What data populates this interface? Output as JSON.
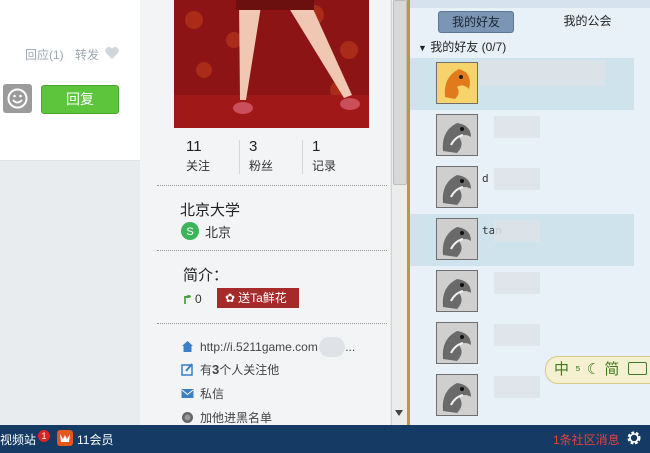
{
  "feed": {
    "reply_count_label": "回应(1)",
    "forward_label": "转发",
    "reply_button": "回复"
  },
  "profile": {
    "stats": [
      {
        "num": "11",
        "label": "关注"
      },
      {
        "num": "3",
        "label": "粉丝"
      },
      {
        "num": "1",
        "label": "记录"
      }
    ],
    "school": "北京大学",
    "city": "北京",
    "intro_title": "简介：",
    "flower_count": "0",
    "send_flower_label": "送Ta鲜花",
    "links": {
      "homepage": "http://i.5211game.com",
      "homepage_more": "...",
      "followers_pre": "有",
      "followers_num": "3",
      "followers_post": "个人关注他",
      "message": "私信",
      "blacklist": "加他进黑名单"
    }
  },
  "friends_panel": {
    "tab_friends": "我的好友",
    "tab_guild": "我的公会",
    "group_arrow": "▼",
    "group_label": "我的好友",
    "group_count": "(0/7)",
    "friends": [
      {
        "name": "",
        "highlighted": true
      },
      {
        "name": "",
        "highlighted": false
      },
      {
        "name": "d",
        "highlighted": false
      },
      {
        "name": "tan",
        "highlighted": true
      },
      {
        "name": "",
        "highlighted": false
      },
      {
        "name": "",
        "highlighted": false
      },
      {
        "name": "",
        "highlighted": false
      }
    ],
    "ime": "中",
    "ime_mode": "简"
  },
  "taskbar": {
    "video_label": "视频站",
    "video_badge": "1",
    "members_label": "11会员",
    "notify_label": "1条社区消息"
  },
  "colors": {
    "reply_green": "#5cc53b",
    "flower_red": "#a52a2a",
    "taskbar_blue": "#153a63",
    "notify_red": "#e24141"
  }
}
